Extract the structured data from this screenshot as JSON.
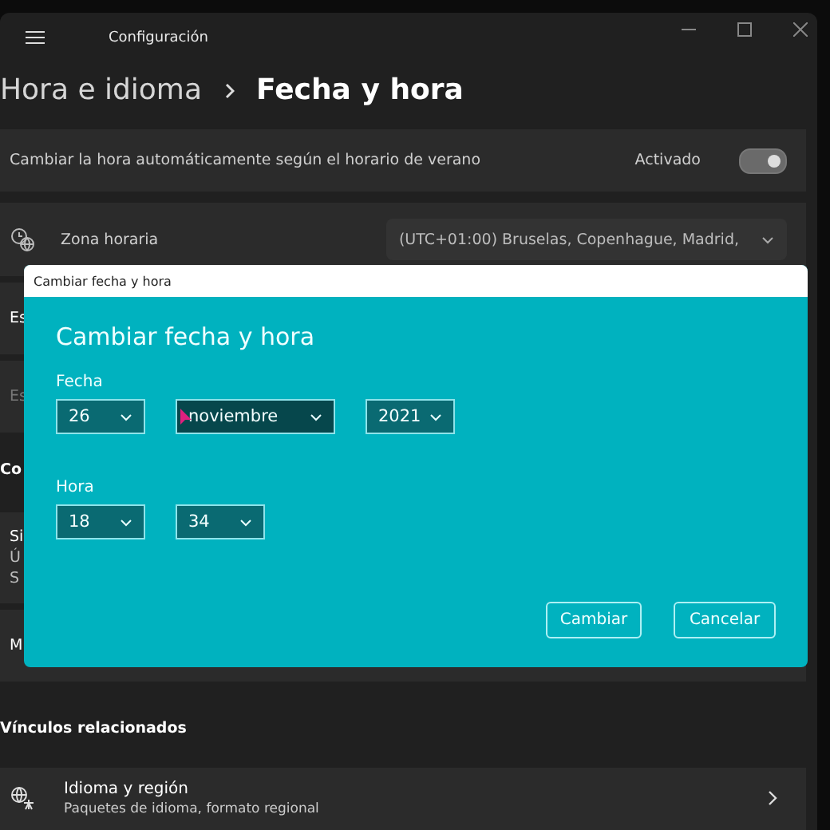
{
  "window": {
    "title": "Configuración"
  },
  "breadcrumb": {
    "parent": "Hora e idioma",
    "current": "Fecha y hora"
  },
  "settings": [
    {
      "kind": "toggle",
      "label": "Cambiar la hora automáticamente según el horario de verano",
      "state_label": "Activado",
      "on": true
    },
    {
      "kind": "dropdown",
      "label": "Zona horaria",
      "value": "(UTC+01:00) Bruselas, Copenhague, Madrid,"
    },
    {
      "kind": "hidden",
      "lines": [
        "Es"
      ],
      "disabled": false
    },
    {
      "kind": "hidden",
      "lines": [
        "Es"
      ],
      "disabled": true
    },
    {
      "kind": "section",
      "lines": [
        "Co"
      ]
    },
    {
      "kind": "hidden",
      "lines": [
        "Si",
        "Ú",
        "S"
      ],
      "disabled": false
    },
    {
      "kind": "hidden",
      "lines": [
        "M"
      ],
      "disabled": false
    }
  ],
  "related": {
    "heading": "Vínculos relacionados",
    "items": [
      {
        "title": "Idioma y región",
        "subtitle": "Paquetes de idioma, formato regional"
      }
    ]
  },
  "dialog": {
    "window_title": "Cambiar fecha y hora",
    "heading": "Cambiar fecha y hora",
    "groups": [
      {
        "label": "Fecha",
        "fields": [
          {
            "value": "26",
            "focused": false
          },
          {
            "value": "noviembre",
            "focused": true
          },
          {
            "value": "2021",
            "focused": false
          }
        ]
      },
      {
        "label": "Hora",
        "fields": [
          {
            "value": "18",
            "focused": false
          },
          {
            "value": "34",
            "focused": false
          }
        ]
      }
    ],
    "buttons": [
      "Cambiar",
      "Cancelar"
    ]
  }
}
